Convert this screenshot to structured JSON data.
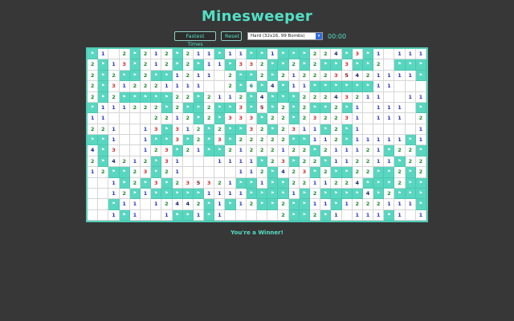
{
  "title": "Minesweeper",
  "controls": {
    "fastest_label": "Fastest Times",
    "reset_label": "Reset",
    "difficulty_selected": "Hard (32x16, 99 Bombs)",
    "timer": "00:00"
  },
  "status": "You're a Winner!",
  "colors": {
    "accent": "#53dfc4",
    "flag_cell": "#59d6bf",
    "background": "#373737"
  },
  "board": {
    "cols": 32,
    "rows": 16,
    "flag_glyph": "⚑",
    "grid": [
      [
        "F",
        "1",
        "",
        "2",
        "F",
        "2",
        "1",
        "2",
        "F",
        "2",
        "1",
        "1",
        "F",
        "1",
        "1",
        "F",
        "F",
        "1",
        "F",
        "F",
        "F",
        "2",
        "2",
        "4",
        "F",
        "3",
        "F",
        "1",
        "",
        "1",
        "1",
        "1"
      ],
      [
        "2",
        "F",
        "1",
        "3",
        "F",
        "2",
        "1",
        "2",
        "F",
        "2",
        "F",
        "1",
        "1",
        "F",
        "3",
        "3",
        "2",
        "F",
        "F",
        "2",
        "F",
        "2",
        "F",
        "F",
        "3",
        "F",
        "F",
        "2",
        "",
        "F",
        "F",
        "F"
      ],
      [
        "2",
        "F",
        "2",
        "F",
        "F",
        "2",
        "F",
        "F",
        "1",
        "2",
        "1",
        "1",
        "",
        "2",
        "F",
        "F",
        "2",
        "F",
        "2",
        "1",
        "2",
        "2",
        "2",
        "3",
        "5",
        "4",
        "2",
        "1",
        "1",
        "1",
        "1",
        "F"
      ],
      [
        "2",
        "F",
        "3",
        "1",
        "2",
        "2",
        "2",
        "1",
        "1",
        "1",
        "1",
        "",
        "",
        "2",
        "F",
        "6",
        "F",
        "4",
        "F",
        "1",
        "1",
        "F",
        "F",
        "F",
        "F",
        "F",
        "F",
        "1",
        "1",
        "",
        "",
        ""
      ],
      [
        "2",
        "F",
        "2",
        "F",
        "F",
        "F",
        "F",
        "F",
        "2",
        "2",
        "F",
        "2",
        "1",
        "1",
        "2",
        "F",
        "4",
        "F",
        "F",
        "F",
        "2",
        "2",
        "2",
        "4",
        "3",
        "2",
        "1",
        "1",
        "",
        "",
        "1",
        "1"
      ],
      [
        "F",
        "1",
        "1",
        "1",
        "2",
        "2",
        "2",
        "F",
        "2",
        "F",
        "F",
        "2",
        "F",
        "F",
        "3",
        "F",
        "5",
        "F",
        "2",
        "F",
        "2",
        "F",
        "F",
        "2",
        "F",
        "1",
        "",
        "1",
        "1",
        "1",
        "",
        "F"
      ],
      [
        "1",
        "1",
        "",
        "",
        "",
        "",
        "2",
        "2",
        "1",
        "2",
        "F",
        "2",
        "F",
        "3",
        "3",
        "3",
        "F",
        "2",
        "2",
        "F",
        "2",
        "3",
        "2",
        "2",
        "3",
        "1",
        "",
        "1",
        "1",
        "1",
        "",
        "2"
      ],
      [
        "2",
        "2",
        "1",
        "",
        "",
        "1",
        "3",
        "F",
        "3",
        "1",
        "2",
        "F",
        "2",
        "F",
        "F",
        "3",
        "2",
        "F",
        "2",
        "3",
        "1",
        "1",
        "F",
        "2",
        "F",
        "1",
        "",
        "",
        "",
        "",
        "",
        "1"
      ],
      [
        "F",
        "F",
        "1",
        "",
        "",
        "1",
        "F",
        "F",
        "3",
        "F",
        "2",
        "F",
        "3",
        "F",
        "2",
        "2",
        "2",
        "2",
        "2",
        "F",
        "F",
        "1",
        "1",
        "2",
        "F",
        "1",
        "1",
        "1",
        "1",
        "1",
        "F",
        "1"
      ],
      [
        "4",
        "F",
        "3",
        "",
        "",
        "1",
        "2",
        "3",
        "F",
        "2",
        "1",
        "F",
        "F",
        "2",
        "1",
        "2",
        "2",
        "2",
        "1",
        "2",
        "2",
        "F",
        "2",
        "1",
        "1",
        "1",
        "2",
        "1",
        "F",
        "2",
        "2",
        "F"
      ],
      [
        "2",
        "F",
        "4",
        "2",
        "1",
        "2",
        "F",
        "3",
        "1",
        "",
        "",
        "",
        "1",
        "1",
        "1",
        "1",
        "F",
        "2",
        "3",
        "F",
        "2",
        "2",
        "F",
        "1",
        "1",
        "2",
        "2",
        "1",
        "1",
        "F",
        "2",
        "2"
      ],
      [
        "1",
        "2",
        "F",
        "F",
        "2",
        "3",
        "F",
        "2",
        "1",
        "",
        "",
        "",
        "",
        "",
        "1",
        "1",
        "2",
        "F",
        "4",
        "2",
        "3",
        "F",
        "2",
        "F",
        "F",
        "2",
        "2",
        "F",
        "F",
        "2",
        "F",
        "2"
      ],
      [
        "",
        "",
        "1",
        "F",
        "2",
        "F",
        "3",
        "F",
        "2",
        "3",
        "5",
        "3",
        "2",
        "1",
        "F",
        "F",
        "1",
        "F",
        "F",
        "2",
        "2",
        "1",
        "1",
        "2",
        "2",
        "4",
        "F",
        "F",
        "F",
        "2",
        "F",
        "F"
      ],
      [
        "",
        "",
        "1",
        "2",
        "F",
        "1",
        "F",
        "F",
        "F",
        "F",
        "F",
        "1",
        "1",
        "1",
        "1",
        "F",
        "F",
        "F",
        "F",
        "1",
        "F",
        "2",
        "F",
        "F",
        "F",
        "F",
        "4",
        "F",
        "2",
        "F",
        "F",
        "F"
      ],
      [
        "",
        "",
        "F",
        "1",
        "1",
        "",
        "1",
        "2",
        "4",
        "4",
        "2",
        "F",
        "1",
        "F",
        "1",
        "2",
        "F",
        "F",
        "2",
        "F",
        "F",
        "1",
        "1",
        "F",
        "1",
        "2",
        "2",
        "2",
        "1",
        "1",
        "1",
        "F"
      ],
      [
        "",
        "",
        "1",
        "F",
        "1",
        "",
        "",
        "1",
        "F",
        "F",
        "1",
        "F",
        "1",
        "",
        "",
        "",
        "",
        "",
        "2",
        "F",
        "F",
        "2",
        "F",
        "1",
        "",
        "1",
        "1",
        "1",
        "F",
        "1",
        "",
        "1"
      ]
    ]
  }
}
